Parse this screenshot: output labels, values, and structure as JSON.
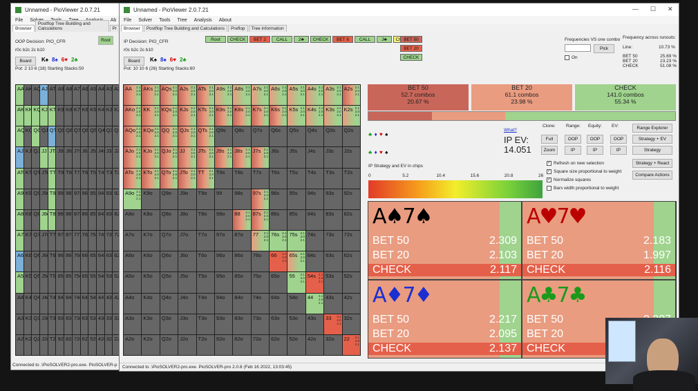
{
  "back_window": {
    "title": "Unnamed - PioViewer 2.0.7.21",
    "menu": [
      "File",
      "Solver",
      "Tools",
      "Tree",
      "Analysis",
      "Ab"
    ],
    "tabs": [
      "Browser",
      "Postflop Tree Building and Calculations",
      "Pr"
    ],
    "decision": "OOP Decision: PIO_CFR",
    "board_code": "r0c b2c 2c b10",
    "board_button": "Board",
    "board_cards": [
      {
        "t": "K",
        "s": "♠",
        "c": "#000"
      },
      {
        "t": "8",
        "s": "♠",
        "c": "#1a2fd0"
      },
      {
        "t": "6",
        "s": "♥",
        "c": "#d00"
      },
      {
        "t": "2",
        "s": "♣",
        "c": "#1a9a1a"
      }
    ],
    "pot": "Pot: 2 10 6 (18) Starting Stacks:50",
    "root_button": "Root",
    "status": "Connected to .\\PioSOLVER2-pro.exe. PioSOLVER-p"
  },
  "front_window": {
    "title": "Unnamed - PioViewer 2.0.7.21",
    "menu": [
      "File",
      "Solver",
      "Tools",
      "Tree",
      "Analysis",
      "About"
    ],
    "tabs": [
      "Browser",
      "Postflop Tree Building and Calculations",
      "Preflop",
      "Tree information"
    ],
    "decision": "IP Decision: PIO_CFR",
    "board_code": "r0c b2c 2c b10",
    "board_button": "Board",
    "board_cards": [
      {
        "t": "K",
        "s": "♠",
        "c": "#000"
      },
      {
        "t": "8",
        "s": "♠",
        "c": "#1a2fd0"
      },
      {
        "t": "6",
        "s": "♥",
        "c": "#d00"
      },
      {
        "t": "2",
        "s": "♣",
        "c": "#1a9a1a"
      }
    ],
    "pot": "Pot: 10 10 6 (26) Starting Stacks:60",
    "action_sequence": [
      {
        "label": "Root",
        "color": "#9fd38e"
      },
      {
        "label": "CHECK",
        "color": "#9fd38e"
      },
      {
        "label": "BET 2",
        "color": "#e5604a"
      },
      {
        "label": "CALL",
        "color": "#9fd38e"
      },
      {
        "label": "2♣",
        "color": "#9fd38e"
      },
      {
        "label": "CHECK",
        "color": "#9fd38e"
      },
      {
        "label": "BET 8",
        "color": "#e5604a"
      },
      {
        "label": "CALL",
        "color": "#9fd38e"
      },
      {
        "label": "J♣",
        "color": "#9fd38e"
      },
      {
        "label": "CHECK",
        "color": "#f2f07a"
      }
    ],
    "next_actions": [
      {
        "label": "BET 50",
        "color": "#c9665a"
      },
      {
        "label": "BET 20",
        "color": "#e5604a"
      },
      {
        "label": "CHECK",
        "color": "#9fd38e"
      }
    ],
    "freq_vs_combo_label": "Frequencies VS one combo",
    "pick_button": "Pick",
    "on_label": "On",
    "freq_runouts_label": "Frequency across runouts:",
    "line_label": "Line:",
    "line_value": "10.73 %",
    "runout_freqs": [
      {
        "name": "BET 50",
        "val": "25.69 %"
      },
      {
        "name": "BET 20",
        "val": "23.23 %"
      },
      {
        "name": "CHECK",
        "val": "51.08 %"
      }
    ],
    "strategy_boxes": [
      {
        "title": "BET 50",
        "combos": "52.7 combos",
        "pct": "20.67 %",
        "color": "#c9665a"
      },
      {
        "title": "BET 20",
        "combos": "61.1 combos",
        "pct": "23.98 %",
        "color": "#e99c80"
      },
      {
        "title": "CHECK",
        "combos": "141.0 combos",
        "pct": "55.34 %",
        "color": "#9fd38e"
      }
    ],
    "what_link": "What?",
    "ev_title": "IP EV:",
    "ev_value": "14.051",
    "clone_label": "Clone:",
    "range_label": "Range:",
    "equity_label": "Equity:",
    "ev_label": "EV:",
    "buttons": {
      "full": "Full",
      "zoom": "Zoom",
      "oop": "OOP",
      "ip": "IP",
      "range_explorer": "Range Explorer",
      "strategy_ev": "Strategy + EV",
      "strategy": "Strategy",
      "strategy_react": "Strategy + React",
      "compare_actions": "Compare Actions"
    },
    "checkboxes": [
      {
        "label": "Refresh on new selection",
        "checked": true
      },
      {
        "label": "Square size proportional to weight",
        "checked": true
      },
      {
        "label": "Normalize squares",
        "checked": true
      },
      {
        "label": "Bars width proportional to weight",
        "checked": false
      }
    ],
    "ev_scale_label": "IP Strategy and EV in chips",
    "ev_scale_ticks": [
      "0",
      "5.2",
      "10.4",
      "15.6",
      "20.8",
      "26"
    ],
    "combo_details": [
      {
        "rank1": "A",
        "rank2": "7",
        "suit": "♠",
        "color": "#000",
        "rows": [
          {
            "n": "BET 50",
            "v": "2.309"
          },
          {
            "n": "BET 20",
            "v": "2.103"
          },
          {
            "n": "CHECK",
            "v": "2.117"
          }
        ]
      },
      {
        "rank1": "A",
        "rank2": "7",
        "suit": "♥",
        "color": "#b00",
        "rows": [
          {
            "n": "BET 50",
            "v": "2.183"
          },
          {
            "n": "BET 20",
            "v": "1.997"
          },
          {
            "n": "CHECK",
            "v": "2.116"
          }
        ]
      },
      {
        "rank1": "A",
        "rank2": "7",
        "suit": "♦",
        "color": "#1a2fd0",
        "rows": [
          {
            "n": "BET 50",
            "v": "2.217"
          },
          {
            "n": "BET 20",
            "v": "2.095"
          },
          {
            "n": "CHECK",
            "v": "2.137"
          }
        ]
      },
      {
        "rank1": "A",
        "rank2": "7",
        "suit": "♣",
        "color": "#1a9a1a",
        "rows": [
          {
            "n": "BET 50",
            "v": "2.207"
          },
          {
            "n": "BET 20",
            "v": "2.093"
          },
          {
            "n": "CHECK",
            "v": "2.117"
          }
        ]
      }
    ],
    "status": "Connected to .\\PioSOLVER2-pro.exe. PioSOLVER-pro 2.0.8 (Feb 16 2022, 13:03:45)"
  },
  "ranks": [
    "A",
    "K",
    "Q",
    "J",
    "T",
    "9",
    "8",
    "7",
    "6",
    "5",
    "4",
    "3",
    "2"
  ],
  "colors": {
    "bet50": "#c9665a",
    "bet20": "#e5604a",
    "check": "#9fd38e",
    "empty": "#666666",
    "oop_accent": "#7bb0d8"
  }
}
